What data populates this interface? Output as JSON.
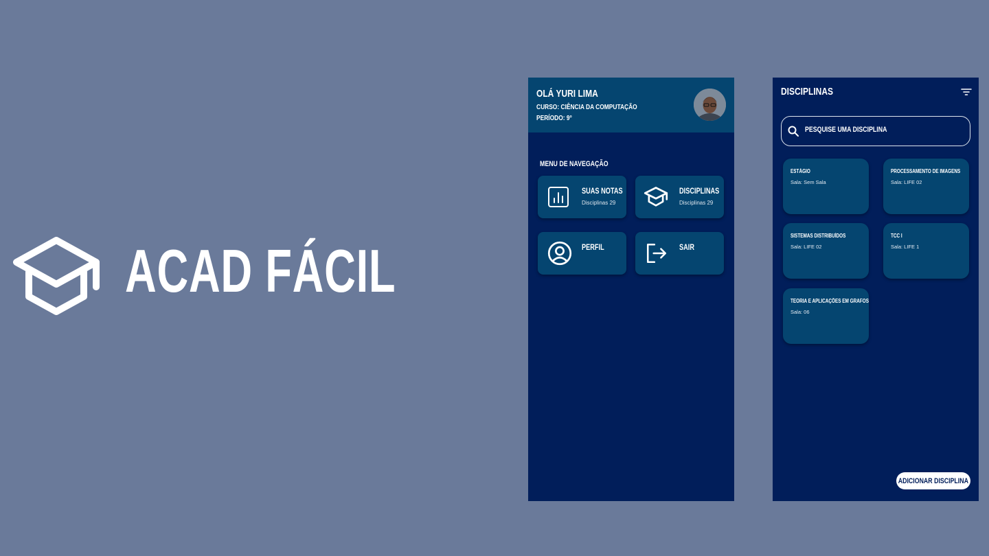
{
  "brand": {
    "title": "ACAD FÁCIL",
    "icon": "graduation-cap-icon"
  },
  "home": {
    "greeting": "OLÁ YURI LIMA",
    "curso": "CURSO: CIÊNCIA DA COMPUTAÇÃO",
    "periodo": "PERÍODO: 9°",
    "nav_title": "MENU DE NAVEGAÇÃO",
    "tiles": [
      {
        "label": "SUAS NOTAS",
        "sub": "Disciplinas 29",
        "icon": "bar-chart-icon"
      },
      {
        "label": "DISCIPLINAS",
        "sub": "Disciplinas 29",
        "icon": "graduation-cap-icon"
      },
      {
        "label": "PERFIL",
        "sub": "",
        "icon": "user-circle-icon"
      },
      {
        "label": "SAIR",
        "sub": "",
        "icon": "logout-icon"
      }
    ]
  },
  "disciplinas": {
    "title": "DISCIPLINAS",
    "search_placeholder": "PESQUISE UMA DISCIPLINA",
    "cards": [
      {
        "name": "ESTÁGIO",
        "room": "Sala: Sem Sala"
      },
      {
        "name": "PROCESSAMENTO DE IMAGENS",
        "room": "Sala: LIFE 02"
      },
      {
        "name": "SISTEMAS DISTRIBUÍDOS",
        "room": "Sala: LIFE 02"
      },
      {
        "name": "TCC I",
        "room": "Sala: LIFE 1"
      },
      {
        "name": "TEORIA E APLICAÇÕES EM GRAFOS",
        "room": "Sala: 06"
      }
    ],
    "add_button": "ADICIONAR DISCIPLINA"
  },
  "colors": {
    "background": "#6a7a9a",
    "panel": "#011e5a",
    "tile": "#054570",
    "white": "#ffffff"
  }
}
